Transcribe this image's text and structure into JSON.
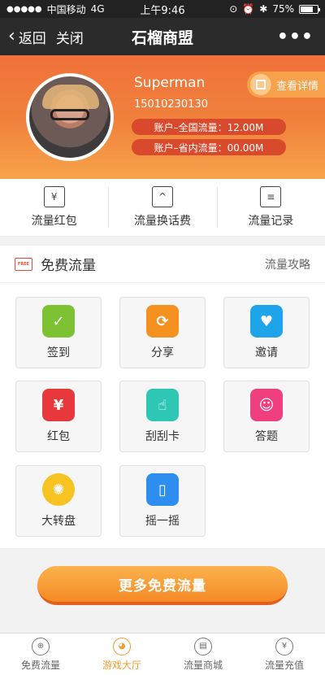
{
  "status_bar": {
    "carrier": "中国移动",
    "network": "4G",
    "time": "上午9:46",
    "battery": "75%",
    "battery_level": 0.75
  },
  "nav": {
    "back": "返回",
    "close": "关闭",
    "title": "石榴商盟",
    "more": "•••"
  },
  "profile": {
    "username": "Superman",
    "phone": "15010230130",
    "national_flow": "账户–全国流量：12.00M",
    "province_flow": "账户–省内流量：00.00M",
    "detail_button": "查看详情"
  },
  "quick_actions": [
    {
      "label": "流量红包",
      "icon": "envelope-yuan-icon",
      "glyph": "¥"
    },
    {
      "label": "流量换话费",
      "icon": "phone-card-icon",
      "glyph": "^"
    },
    {
      "label": "流量记录",
      "icon": "notebook-icon",
      "glyph": "≡"
    }
  ],
  "section": {
    "tag": "FREE",
    "title": "免费流量",
    "link": "流量攻略"
  },
  "tasks": [
    {
      "label": "签到",
      "icon": "calendar-check-icon",
      "glyph": "✓",
      "color": "#7cc233"
    },
    {
      "label": "分享",
      "icon": "share-icon",
      "glyph": "⟳",
      "color": "#f5911e"
    },
    {
      "label": "邀请",
      "icon": "invite-heart-icon",
      "glyph": "♥",
      "color": "#1ea4e9"
    },
    {
      "label": "红包",
      "icon": "red-packet-icon",
      "glyph": "¥",
      "color": "#e8383b"
    },
    {
      "label": "刮刮卡",
      "icon": "scratch-card-icon",
      "glyph": "☝",
      "color": "#2ec7b4"
    },
    {
      "label": "答题",
      "icon": "quiz-chat-icon",
      "glyph": "☺",
      "color": "#ef3f7f"
    },
    {
      "label": "大转盘",
      "icon": "lucky-wheel-icon",
      "glyph": "✺",
      "color": "#f7c320"
    },
    {
      "label": "摇一摇",
      "icon": "shake-phone-icon",
      "glyph": "▯",
      "color": "#2d8ef0"
    }
  ],
  "more_button": "更多免费流量",
  "tabs": [
    {
      "label": "免费流量",
      "icon": "free-flow-icon",
      "glyph": "⊕",
      "active": false
    },
    {
      "label": "游戏大厅",
      "icon": "game-icon",
      "glyph": "◕",
      "active": true
    },
    {
      "label": "流量商城",
      "icon": "mall-icon",
      "glyph": "▤",
      "active": false
    },
    {
      "label": "流量充值",
      "icon": "recharge-icon",
      "glyph": "¥",
      "active": false
    }
  ]
}
